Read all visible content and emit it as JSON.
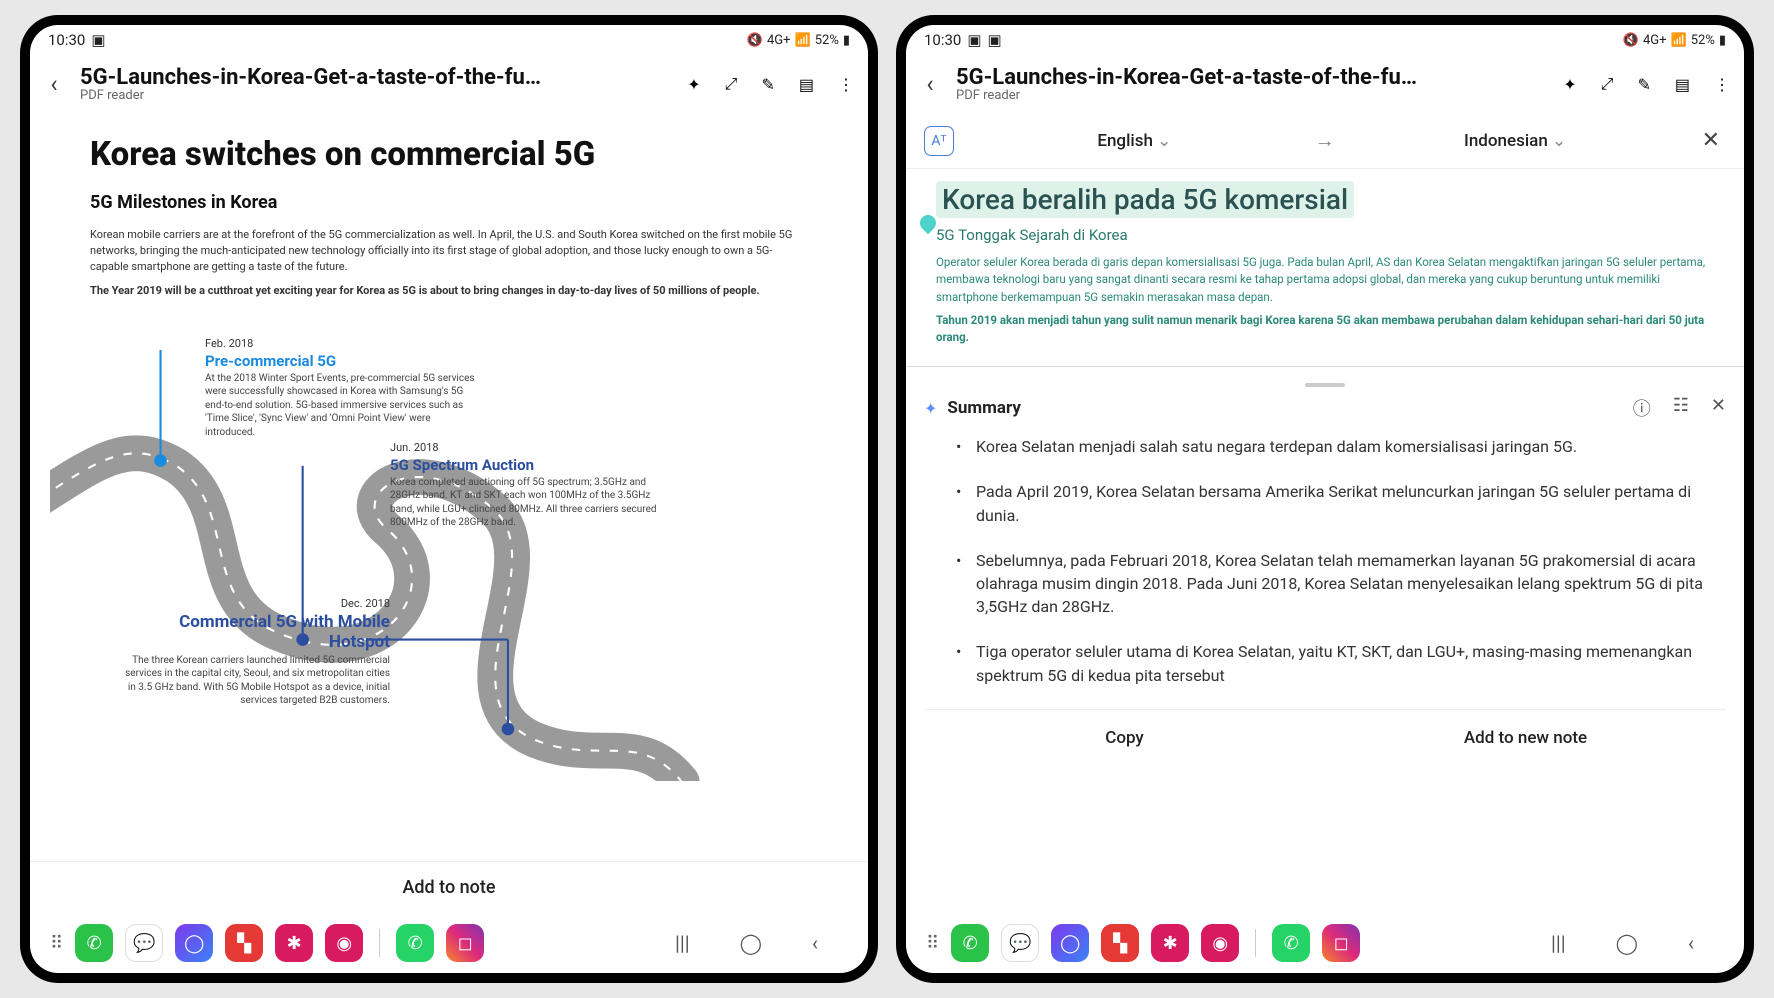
{
  "left": {
    "status": {
      "time": "10:30",
      "battery": "52%",
      "net": "4G+"
    },
    "header": {
      "title": "5G-Launches-in-Korea-Get-a-taste-of-the-fu…",
      "subtitle": "PDF reader"
    },
    "pdf": {
      "h1": "Korea switches on commercial 5G",
      "h2": "5G Milestones in Korea",
      "p1": "Korean mobile carriers are at the forefront of the 5G commercialization as well. In April, the U.S. and South Korea switched on the first mobile 5G networks, bringing the much-anticipated new technology officially into its first stage of global adoption, and those lucky enough to own a 5G-capable smartphone are getting a taste of the future.",
      "p2": "The Year 2019 will be a cutthroat yet exciting year for Korea as 5G is about to bring changes in day-to-day lives of 50 millions of people.",
      "events": [
        {
          "date": "Feb. 2018",
          "name": "Pre-commercial 5G",
          "desc": "At the 2018 Winter Sport Events, pre-commercial 5G services were successfully showcased in Korea with Samsung's 5G end-to-end solution. 5G-based immersive services such as 'Time Slice', 'Sync View' and 'Omni Point View' were introduced."
        },
        {
          "date": "Jun. 2018",
          "name": "5G Spectrum Auction",
          "desc": "Korea completed auctioning off 5G spectrum; 3.5GHz and 28GHz band. KT and SKT each won 100MHz of the 3.5GHz band, while LGU+ clinched 80MHz. All three carriers secured 800MHz of the 28GHz band."
        },
        {
          "date": "Dec. 2018",
          "name": "Commercial 5G with Mobile Hotspot",
          "desc": "The three Korean carriers launched limited 5G commercial services in the capital city, Seoul, and six metropolitan cities in 3.5 GHz band. With 5G Mobile Hotspot as a device, initial services targeted B2B customers."
        }
      ]
    },
    "footer": {
      "add_note": "Add to note"
    }
  },
  "right": {
    "status": {
      "time": "10:30",
      "battery": "52%",
      "net": "4G+"
    },
    "header": {
      "title": "5G-Launches-in-Korea-Get-a-taste-of-the-fu…",
      "subtitle": "PDF reader"
    },
    "translate": {
      "source": "English",
      "target": "Indonesian"
    },
    "translated": {
      "h1": "Korea beralih pada 5G komersial",
      "h2": "5G Tonggak Sejarah di Korea",
      "p1": "Operator seluler Korea berada di garis depan komersialisasi 5G juga. Pada bulan April, AS dan Korea Selatan mengaktifkan jaringan 5G seluler pertama, membawa teknologi baru yang sangat dinanti secara resmi ke tahap pertama adopsi global, dan mereka yang cukup beruntung untuk memiliki smartphone berkemampuan 5G semakin merasakan masa depan.",
      "p2": "Tahun 2019 akan menjadi tahun yang sulit namun menarik bagi Korea karena 5G akan membawa perubahan dalam kehidupan sehari-hari dari 50 juta orang."
    },
    "summary": {
      "title": "Summary",
      "items": [
        "Korea Selatan menjadi salah satu negara terdepan dalam komersialisasi jaringan 5G.",
        "Pada April 2019, Korea Selatan bersama Amerika Serikat meluncurkan jaringan 5G seluler pertama di dunia.",
        "Sebelumnya, pada Februari 2018, Korea Selatan telah memamerkan layanan 5G prakomersial di acara olahraga musim dingin 2018. Pada Juni 2018, Korea Selatan menyelesaikan lelang spektrum 5G di pita 3,5GHz dan 28GHz.",
        "Tiga operator seluler utama di Korea Selatan, yaitu KT, SKT, dan LGU+, masing-masing memenangkan spektrum 5G di kedua pita tersebut"
      ],
      "copy": "Copy",
      "add_new_note": "Add to new note"
    }
  },
  "dock": {
    "colors": [
      "#2bc24a",
      "#3b82f6",
      "#7c3aed",
      "#e1306c",
      "#e1306c",
      "#e1306c",
      "#25d366",
      "#c13584"
    ]
  }
}
